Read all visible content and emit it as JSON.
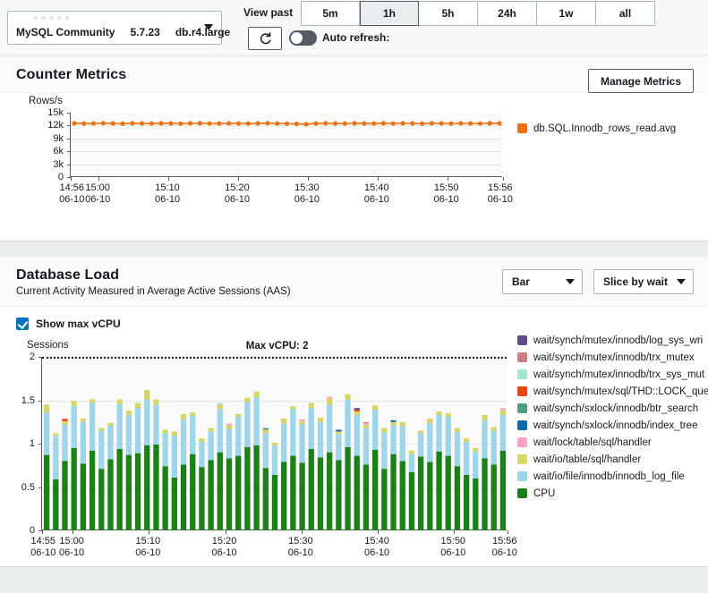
{
  "toolbar": {
    "instance": {
      "engine": "MySQL Community",
      "version": "5.7.23",
      "class": "db.r4.large",
      "caret_icon": "caret-down-icon"
    },
    "view_past_label": "View past",
    "ranges": [
      {
        "label": "5m",
        "active": false
      },
      {
        "label": "1h",
        "active": true
      },
      {
        "label": "5h",
        "active": false
      },
      {
        "label": "24h",
        "active": false
      },
      {
        "label": "1w",
        "active": false
      },
      {
        "label": "all",
        "active": false
      }
    ],
    "refresh_icon": "refresh-icon",
    "auto_refresh_label": "Auto refresh:",
    "auto_refresh_on": false
  },
  "counter_metrics": {
    "title": "Counter Metrics",
    "manage_button": "Manage Metrics"
  },
  "database_load": {
    "title": "Database Load",
    "subtitle": "Current Activity Measured in Average Active Sessions (AAS)",
    "chart_type_dropdown": "Bar",
    "slice_dropdown": "Slice by wait",
    "show_max_vcpu_label": "Show max vCPU",
    "show_max_vcpu_checked": true,
    "max_vcpu_annotation": "Max vCPU: 2"
  },
  "chart_data": [
    {
      "id": "counter-metrics-chart",
      "type": "line",
      "title": "",
      "ylabel": "Rows/s",
      "xlabel": "",
      "ylim": [
        0,
        15000
      ],
      "yticks": [
        0,
        3000,
        6000,
        9000,
        12000,
        15000
      ],
      "ytick_labels": [
        "0",
        "3k",
        "6k",
        "9k",
        "12k",
        "15k"
      ],
      "grid": true,
      "legend_position": "right",
      "legend": [
        {
          "name": "db.SQL.Innodb_rows_read.avg",
          "color": "#ec7211"
        }
      ],
      "xticks": [
        {
          "pos": 0,
          "time": "14:56",
          "date": "06-10"
        },
        {
          "pos": 0.0645,
          "time": "15:00",
          "date": "06-10"
        },
        {
          "pos": 0.2258,
          "time": "15:10",
          "date": "06-10"
        },
        {
          "pos": 0.3871,
          "time": "15:20",
          "date": "06-10"
        },
        {
          "pos": 0.5484,
          "time": "15:30",
          "date": "06-10"
        },
        {
          "pos": 0.7097,
          "time": "15:40",
          "date": "06-10"
        },
        {
          "pos": 0.871,
          "time": "15:50",
          "date": "06-10"
        },
        {
          "pos": 1.0,
          "time": "15:56",
          "date": "06-10"
        }
      ],
      "series": [
        {
          "name": "db.SQL.Innodb_rows_read.avg",
          "color": "#ec7211",
          "values": [
            12530,
            12480,
            12520,
            12560,
            12500,
            12470,
            12540,
            12510,
            12480,
            12530,
            12500,
            12460,
            12520,
            12550,
            12490,
            12470,
            12530,
            12500,
            12480,
            12520,
            12560,
            12490,
            12450,
            12400,
            12330,
            12480,
            12520,
            12500,
            12470,
            12540,
            12510,
            12480,
            12530,
            12490,
            12520,
            12500,
            12470,
            12540,
            12510,
            12480,
            12520,
            12500,
            12480,
            12530,
            12510
          ]
        }
      ]
    },
    {
      "id": "database-load-chart",
      "type": "bar",
      "stacked": true,
      "title": "",
      "ylabel": "Sessions",
      "xlabel": "",
      "ylim": [
        0,
        2
      ],
      "yticks": [
        0,
        0.5,
        1,
        1.5,
        2
      ],
      "ytick_labels": [
        "0",
        "0.5",
        "1",
        "1.5",
        "2"
      ],
      "grid": true,
      "threshold_line": {
        "value": 2,
        "label": "Max vCPU: 2",
        "style": "dotted"
      },
      "legend_position": "right",
      "legend": [
        {
          "name": "wait/synch/mutex/innodb/log_sys_wri",
          "color": "#5c4b8b"
        },
        {
          "name": "wait/synch/mutex/innodb/trx_mutex",
          "color": "#c87f82"
        },
        {
          "name": "wait/synch/mutex/innodb/trx_sys_mut",
          "color": "#a2e8c8"
        },
        {
          "name": "wait/synch/mutex/sql/THD::LOCK_quer",
          "color": "#e8450d"
        },
        {
          "name": "wait/synch/sxlock/innodb/btr_search",
          "color": "#4d9b80"
        },
        {
          "name": "wait/synch/sxlock/innodb/index_tree",
          "color": "#1168a8"
        },
        {
          "name": "wait/lock/table/sql/handler",
          "color": "#f5a3c7"
        },
        {
          "name": "wait/io/table/sql/handler",
          "color": "#d6d665"
        },
        {
          "name": "wait/io/file/innodb/innodb_log_file",
          "color": "#9ed5ea"
        },
        {
          "name": "CPU",
          "color": "#1a8017"
        }
      ],
      "xticks": [
        {
          "pos": 0,
          "time": "14:55",
          "date": "06-10"
        },
        {
          "pos": 0.0656,
          "time": "15:00",
          "date": "06-10"
        },
        {
          "pos": 0.2295,
          "time": "15:10",
          "date": "06-10"
        },
        {
          "pos": 0.3934,
          "time": "15:20",
          "date": "06-10"
        },
        {
          "pos": 0.5574,
          "time": "15:30",
          "date": "06-10"
        },
        {
          "pos": 0.7213,
          "time": "15:40",
          "date": "06-10"
        },
        {
          "pos": 0.8852,
          "time": "15:50",
          "date": "06-10"
        },
        {
          "pos": 1.0,
          "time": "15:56",
          "date": "06-10"
        }
      ],
      "stack_order": [
        "CPU",
        "wait/io/file/innodb/innodb_log_file",
        "wait/io/table/sql/handler",
        "wait/lock/table/sql/handler",
        "wait/synch/sxlock/innodb/index_tree",
        "wait/synch/sxlock/innodb/btr_search",
        "wait/synch/mutex/sql/THD::LOCK_quer",
        "wait/synch/mutex/innodb/trx_sys_mut",
        "wait/synch/mutex/innodb/trx_mutex",
        "wait/synch/mutex/innodb/log_sys_wri"
      ],
      "series": [
        {
          "name": "CPU",
          "color": "#1a8017",
          "values": [
            0.87,
            0.59,
            0.8,
            0.95,
            0.77,
            0.92,
            0.71,
            0.82,
            0.94,
            0.87,
            0.89,
            0.98,
            0.99,
            0.74,
            0.61,
            0.76,
            0.88,
            0.73,
            0.81,
            0.9,
            0.83,
            0.86,
            0.96,
            0.98,
            0.72,
            0.64,
            0.79,
            0.86,
            0.78,
            0.94,
            0.84,
            0.9,
            0.81,
            0.96,
            0.86,
            0.76,
            0.93,
            0.71,
            0.88,
            0.8,
            0.67,
            0.85,
            0.79,
            0.91,
            0.86,
            0.74,
            0.64,
            0.6,
            0.83,
            0.76,
            0.92
          ]
        },
        {
          "name": "wait/io/file/innodb/innodb_log_file",
          "color": "#9ed5ea",
          "values": [
            0.49,
            0.5,
            0.42,
            0.49,
            0.48,
            0.55,
            0.44,
            0.39,
            0.52,
            0.46,
            0.52,
            0.53,
            0.46,
            0.38,
            0.48,
            0.52,
            0.44,
            0.29,
            0.33,
            0.5,
            0.34,
            0.45,
            0.52,
            0.55,
            0.4,
            0.34,
            0.44,
            0.54,
            0.44,
            0.47,
            0.41,
            0.55,
            0.3,
            0.55,
            0.47,
            0.42,
            0.46,
            0.42,
            0.33,
            0.4,
            0.21,
            0.27,
            0.45,
            0.42,
            0.45,
            0.39,
            0.38,
            0.31,
            0.44,
            0.39,
            0.41
          ]
        },
        {
          "name": "wait/io/table/sql/handler",
          "color": "#d6d665",
          "values": [
            0.09,
            0.03,
            0.04,
            0.05,
            0.04,
            0.04,
            0.03,
            0.03,
            0.05,
            0.05,
            0.06,
            0.11,
            0.06,
            0.04,
            0.05,
            0.06,
            0.04,
            0.04,
            0.04,
            0.05,
            0.04,
            0.03,
            0.05,
            0.07,
            0.04,
            0.03,
            0.06,
            0.03,
            0.04,
            0.06,
            0.05,
            0.07,
            0.03,
            0.06,
            0.04,
            0.04,
            0.05,
            0.05,
            0.04,
            0.05,
            0.04,
            0.03,
            0.05,
            0.04,
            0.04,
            0.05,
            0.04,
            0.04,
            0.06,
            0.04,
            0.06
          ]
        },
        {
          "name": "wait/lock/table/sql/handler",
          "color": "#f5a3c7",
          "values": [
            0,
            0,
            0,
            0,
            0,
            0,
            0,
            0,
            0,
            0,
            0,
            0,
            0,
            0,
            0,
            0,
            0,
            0,
            0,
            0,
            0.02,
            0,
            0,
            0,
            0,
            0,
            0,
            0,
            0.02,
            0,
            0,
            0.02,
            0,
            0,
            0,
            0.02,
            0,
            0,
            0,
            0,
            0,
            0,
            0,
            0,
            0,
            0,
            0,
            0,
            0,
            0,
            0.02
          ]
        },
        {
          "name": "wait/synch/sxlock/innodb/index_tree",
          "color": "#1168a8",
          "values": [
            0,
            0,
            0,
            0,
            0,
            0,
            0,
            0,
            0,
            0,
            0,
            0,
            0,
            0,
            0,
            0,
            0,
            0,
            0,
            0,
            0,
            0,
            0,
            0,
            0,
            0,
            0,
            0,
            0,
            0,
            0,
            0,
            0.02,
            0,
            0,
            0,
            0,
            0,
            0.02,
            0,
            0,
            0,
            0,
            0,
            0,
            0,
            0,
            0,
            0,
            0,
            0
          ]
        },
        {
          "name": "wait/synch/sxlock/innodb/btr_search",
          "color": "#4d9b80",
          "values": [
            0,
            0,
            0,
            0,
            0,
            0,
            0,
            0,
            0,
            0,
            0,
            0,
            0,
            0,
            0,
            0,
            0,
            0,
            0,
            0,
            0,
            0,
            0,
            0,
            0.02,
            0,
            0,
            0,
            0,
            0,
            0,
            0,
            0,
            0,
            0,
            0,
            0,
            0,
            0,
            0,
            0,
            0,
            0,
            0,
            0,
            0,
            0,
            0,
            0,
            0,
            0
          ]
        },
        {
          "name": "wait/synch/mutex/sql/THD::LOCK_quer",
          "color": "#e8450d",
          "values": [
            0,
            0,
            0.02,
            0,
            0,
            0,
            0,
            0,
            0,
            0,
            0,
            0,
            0,
            0,
            0,
            0,
            0,
            0,
            0,
            0,
            0,
            0,
            0,
            0,
            0,
            0,
            0,
            0,
            0,
            0,
            0,
            0,
            0,
            0,
            0.02,
            0,
            0,
            0,
            0,
            0,
            0,
            0,
            0,
            0,
            0,
            0,
            0,
            0,
            0,
            0,
            0
          ]
        },
        {
          "name": "wait/synch/mutex/innodb/trx_sys_mut",
          "color": "#a2e8c8",
          "values": [
            0,
            0,
            0,
            0,
            0,
            0,
            0,
            0,
            0,
            0,
            0,
            0,
            0,
            0,
            0,
            0,
            0,
            0,
            0,
            0.02,
            0,
            0,
            0,
            0,
            0,
            0,
            0,
            0,
            0,
            0,
            0,
            0,
            0,
            0,
            0,
            0,
            0,
            0,
            0,
            0,
            0,
            0,
            0,
            0,
            0,
            0,
            0,
            0,
            0,
            0,
            0
          ]
        },
        {
          "name": "wait/synch/mutex/innodb/trx_mutex",
          "color": "#c87f82",
          "values": [
            0,
            0,
            0.01,
            0,
            0,
            0,
            0,
            0,
            0,
            0,
            0,
            0,
            0,
            0,
            0,
            0,
            0,
            0,
            0,
            0,
            0,
            0,
            0,
            0,
            0,
            0,
            0,
            0,
            0,
            0,
            0,
            0,
            0,
            0,
            0,
            0.01,
            0,
            0,
            0,
            0,
            0,
            0,
            0,
            0,
            0,
            0,
            0,
            0,
            0,
            0,
            0
          ]
        },
        {
          "name": "wait/synch/mutex/innodb/log_sys_wri",
          "color": "#5c4b8b",
          "values": [
            0,
            0,
            0,
            0,
            0,
            0,
            0,
            0,
            0,
            0,
            0,
            0,
            0,
            0,
            0,
            0,
            0,
            0,
            0,
            0,
            0,
            0,
            0,
            0,
            0,
            0,
            0,
            0,
            0,
            0,
            0,
            0,
            0,
            0,
            0.02,
            0,
            0,
            0,
            0,
            0,
            0,
            0,
            0,
            0,
            0,
            0,
            0,
            0,
            0,
            0,
            0
          ]
        }
      ]
    }
  ]
}
